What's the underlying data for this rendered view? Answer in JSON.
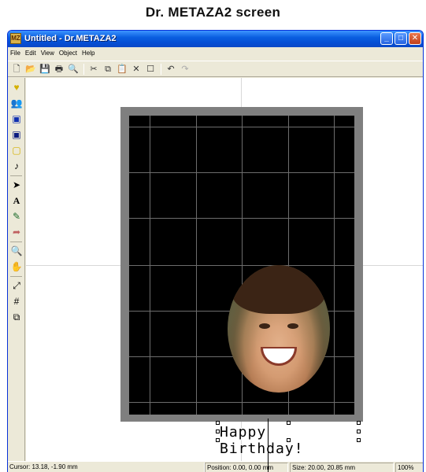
{
  "caption": "Dr. METAZA2 screen",
  "window": {
    "title": "Untitled - Dr.METAZA2",
    "app_icon": "MZ"
  },
  "menu": [
    "File",
    "Edit",
    "View",
    "Object",
    "Help"
  ],
  "toolbar_icons": [
    "new-icon",
    "open-icon",
    "save-icon",
    "print-icon",
    "print-preview-icon",
    "cut-icon",
    "copy-icon",
    "paste-icon",
    "delete-icon",
    "properties-icon",
    "undo-icon",
    "redo-icon"
  ],
  "left_tools": [
    "heart-icon",
    "people-icon",
    "portrait-icon",
    "portrait-dark-icon",
    "frame-icon",
    "note-icon",
    "arrow-icon",
    "text-icon",
    "pen-icon",
    "fill-icon",
    "zoom-icon",
    "hand-icon",
    "fit-icon",
    "grid-icon",
    "layer-icon"
  ],
  "canvas": {
    "text_object": "Happy Birthday!"
  },
  "status": {
    "cursor": "Cursor: 13.18, -1.90 mm",
    "position": "Position: 0.00, 0.00 mm",
    "size": "Size: 20.00, 20.85 mm",
    "zoom": "100%"
  }
}
